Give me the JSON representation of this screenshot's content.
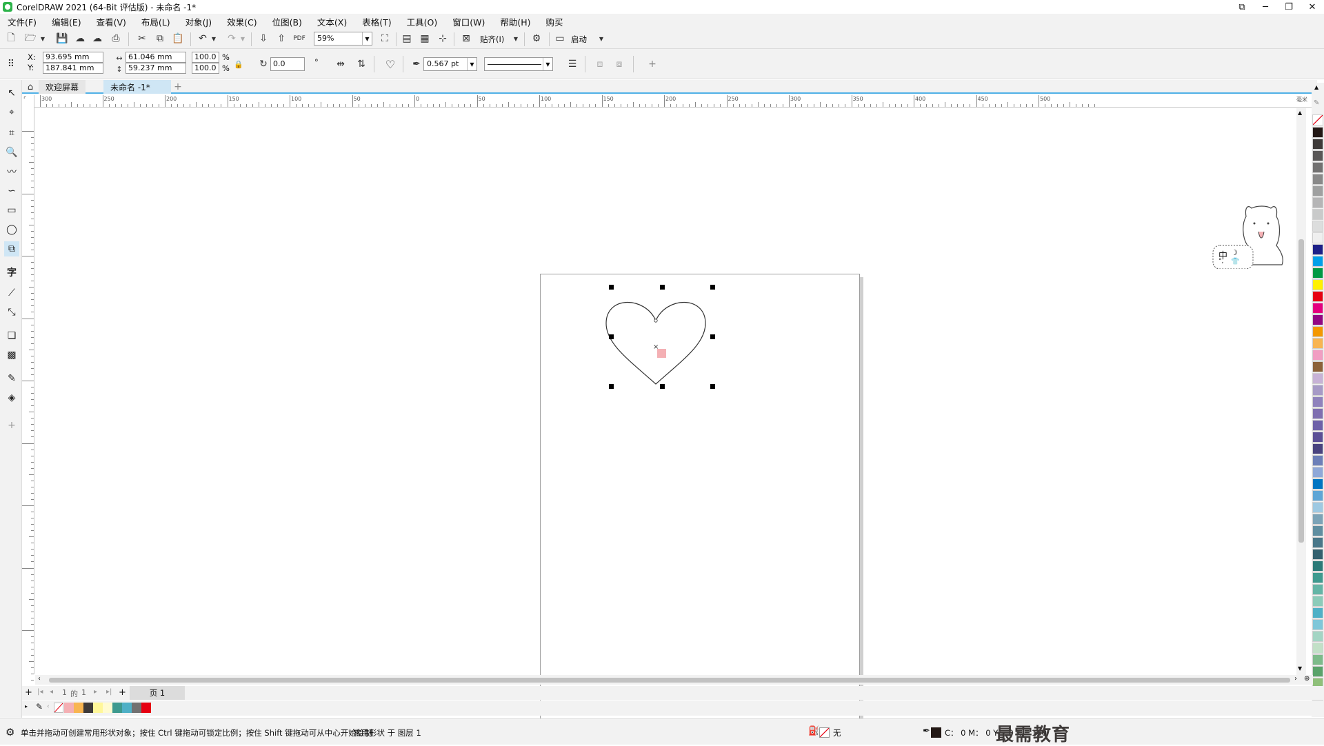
{
  "app": {
    "title": "CorelDRAW 2021 (64-Bit 评估版) - 未命名 -1*"
  },
  "menu": [
    "文件(F)",
    "编辑(E)",
    "查看(V)",
    "布局(L)",
    "对象(J)",
    "效果(C)",
    "位图(B)",
    "文本(X)",
    "表格(T)",
    "工具(O)",
    "窗口(W)",
    "帮助(H)",
    "购买"
  ],
  "standard_toolbar": {
    "zoom": "59%",
    "snap_label": "贴齐(I)",
    "launch_label": "启动"
  },
  "property_bar": {
    "x_label": "X:",
    "y_label": "Y:",
    "x_value": "93.695 mm",
    "y_value": "187.841 mm",
    "width_value": "61.046 mm",
    "height_value": "59.237 mm",
    "scale_x": "100.0",
    "scale_y": "100.0",
    "percent": "%",
    "rotation": "0.0",
    "degree": "°",
    "outline_width": "0.567 pt"
  },
  "tabs": {
    "welcome": "欢迎屏幕",
    "document": "未命名 -1*"
  },
  "ruler": {
    "h_labels": [
      "300",
      "250",
      "200",
      "150",
      "100",
      "50",
      "0",
      "50",
      "100",
      "150",
      "200",
      "250",
      "300",
      "350",
      "400",
      "450",
      "500"
    ],
    "unit": "毫米"
  },
  "page_nav": {
    "current": "1",
    "of": "的",
    "total": "1",
    "page_tab": "页 1"
  },
  "status": {
    "hint": "单击并拖动可创建常用形状对象；按住 Ctrl 键拖动可锁定比例；按住 Shift 键拖动可从中心开始绘制",
    "object_info": "常用形状 于 图层 1",
    "fill_label": "无",
    "outline_info": "C： 0 M： 0 Y： 0 K： 100"
  },
  "watermark": "最需教育",
  "ime": {
    "mode": "中"
  },
  "colors": {
    "palette": [
      "#231815",
      "#3e3a39",
      "#595757",
      "#727171",
      "#898989",
      "#9fa0a0",
      "#b5b5b6",
      "#c9caca",
      "#dcdddd",
      "#efefef",
      "#1d2088",
      "#00a0e9",
      "#009944",
      "#fff100",
      "#e60012",
      "#e4007f",
      "#920783",
      "#f39800",
      "#f8b551",
      "#f19ec2",
      "#8c6239",
      "#c7b2d6",
      "#a69ac6",
      "#8f82bc",
      "#7f6fb0",
      "#6d60a8",
      "#5b4f96",
      "#49437f",
      "#6c7fb8",
      "#8fa8d8",
      "#0075c2",
      "#5fa6d6",
      "#9ec9e2",
      "#7ba3b7",
      "#5f8ea0",
      "#497789",
      "#33616f",
      "#2b7a78",
      "#3e9a8f",
      "#64b5a6",
      "#8ccbb9",
      "#4fb0c6",
      "#7fc7d9",
      "#a3d5c4",
      "#c2e0c7",
      "#7dbb8a",
      "#5aa36a",
      "#8fc07a",
      "#a9cf8b"
    ],
    "docpalette": [
      "#f4b0b4",
      "#f8b551",
      "#3e3a39",
      "#fff799",
      "#fffbd0",
      "#3e9a8f",
      "#4fb0c6",
      "#727171",
      "#e60012"
    ],
    "heart_stroke": "#333333",
    "center_marker": "#f4b0b4",
    "ruler_accent": "#4fb0e6"
  }
}
